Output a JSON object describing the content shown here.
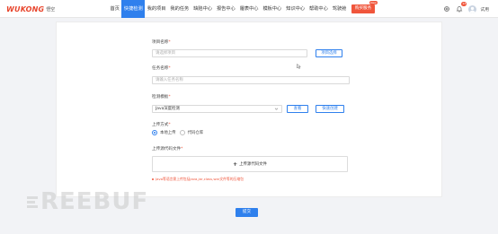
{
  "header": {
    "logo_text": "WUKONG",
    "logo_sub": "悟空",
    "nav": [
      {
        "label": "首页",
        "active": false
      },
      {
        "label": "快捷检测",
        "active": true
      },
      {
        "label": "我的项目",
        "active": false
      },
      {
        "label": "我的任务",
        "active": false
      },
      {
        "label": "缺陷中心",
        "active": false
      },
      {
        "label": "报告中心",
        "active": false
      },
      {
        "label": "履表中心",
        "active": false
      },
      {
        "label": "模板中心",
        "active": false
      },
      {
        "label": "知识中心",
        "active": false
      },
      {
        "label": "帮助中心",
        "active": false
      },
      {
        "label": "驾驶舱",
        "active": false
      }
    ],
    "cta_label": "购买服务",
    "cta_badge": "New",
    "notification_count": "23",
    "username": "试用"
  },
  "form": {
    "project_label": "项目名称",
    "project_placeholder": "请选择项目",
    "project_select_button": "项目选择",
    "task_label": "任务名称",
    "task_placeholder": "请输入任务名称",
    "template_label": "检测模板",
    "template_value": "Java深度检测",
    "template_view_button": "查看",
    "template_create_button": "快速创建",
    "upload_method_label": "上传方式",
    "upload_options": [
      {
        "label": "本地上传",
        "selected": true
      },
      {
        "label": "代码仓库",
        "selected": false
      }
    ],
    "upload_file_label": "上传源代码文件",
    "upload_button_label": "上传源代码文件",
    "upload_hint": "Java等语言需上传包括java,jar,class,war文件等的压缩包"
  },
  "submit_label": "提交",
  "watermark_text": "REEBUF",
  "colors": {
    "accent": "#2f80ed",
    "brand": "#e8452c",
    "warning": "#f0553b",
    "background": "#f2f3f6"
  }
}
